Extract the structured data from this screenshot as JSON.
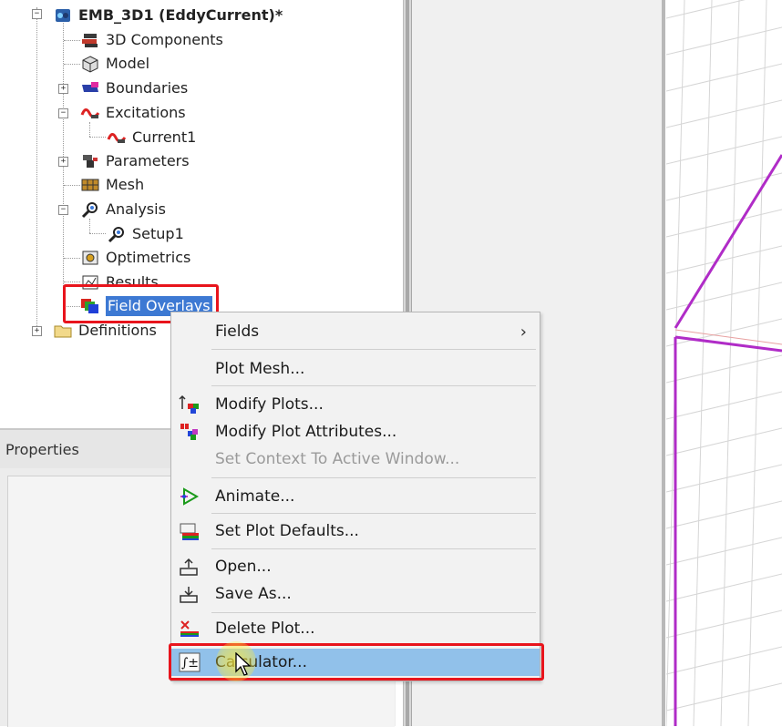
{
  "tree": {
    "root": {
      "label": "EMB_3D1 (EddyCurrent)*"
    },
    "items": [
      {
        "label": "3D Components",
        "icon": "3d-components-icon"
      },
      {
        "label": "Model",
        "icon": "model-icon"
      },
      {
        "label": "Boundaries",
        "icon": "boundaries-icon"
      },
      {
        "label": "Excitations",
        "icon": "excitations-icon"
      },
      {
        "label": "Current1",
        "icon": "current-icon"
      },
      {
        "label": "Parameters",
        "icon": "parameters-icon"
      },
      {
        "label": "Mesh",
        "icon": "mesh-icon"
      },
      {
        "label": "Analysis",
        "icon": "analysis-icon"
      },
      {
        "label": "Setup1",
        "icon": "setup-icon"
      },
      {
        "label": "Optimetrics",
        "icon": "optimetrics-icon"
      },
      {
        "label": "Results",
        "icon": "results-icon"
      },
      {
        "label": "Field Overlays",
        "icon": "field-overlays-icon"
      },
      {
        "label": "Definitions",
        "icon": "folder-icon"
      }
    ]
  },
  "properties": {
    "title": "Properties"
  },
  "context_menu": {
    "items": [
      {
        "label": "Fields",
        "submenu_arrow": "›"
      },
      {
        "label": "Plot Mesh..."
      },
      {
        "label": "Modify Plots..."
      },
      {
        "label": "Modify Plot Attributes..."
      },
      {
        "label": "Set Context To Active Window..."
      },
      {
        "label": "Animate..."
      },
      {
        "label": "Set Plot Defaults..."
      },
      {
        "label": "Open..."
      },
      {
        "label": "Save As..."
      },
      {
        "label": "Delete Plot..."
      },
      {
        "label": "Calculator..."
      }
    ]
  },
  "colors": {
    "highlight_box": "#e8141c",
    "selection": "#3d79d3",
    "menu_hover": "#91c1ea",
    "wireframe": "#b02cc7"
  }
}
